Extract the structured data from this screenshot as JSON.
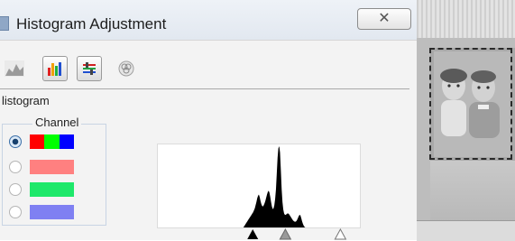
{
  "dialog": {
    "title": "Histogram Adjustment",
    "close_glyph": "✕"
  },
  "toolbar": {
    "tools": [
      {
        "icon": "mountain-histogram-icon",
        "active": false
      },
      {
        "icon": "color-bars-icon",
        "active": true
      },
      {
        "icon": "sliders-icon",
        "active": true
      },
      {
        "icon": "color-wheel-icon",
        "active": false
      }
    ]
  },
  "histogram": {
    "section_label": "listogram",
    "channel_label": "Channel",
    "channels": [
      {
        "name": "rgb",
        "checked": true,
        "colors": [
          "#ff0000",
          "#00ff00",
          "#0000ff"
        ]
      },
      {
        "name": "red",
        "checked": false,
        "colors": [
          "#ff8080"
        ]
      },
      {
        "name": "green",
        "checked": false,
        "colors": [
          "#1ee86a"
        ]
      },
      {
        "name": "blue",
        "checked": false,
        "colors": [
          "#7f80f2"
        ]
      }
    ],
    "distribution": [
      0,
      0,
      0,
      0,
      0,
      0,
      0,
      0,
      0,
      0,
      0,
      0,
      0,
      0,
      0,
      0,
      0,
      0,
      0,
      0,
      0,
      0,
      0,
      0,
      0,
      0,
      0,
      0,
      0,
      0,
      0,
      0,
      0,
      0,
      0,
      0,
      0,
      0,
      0,
      0,
      0,
      0,
      0,
      0,
      0,
      0,
      0,
      0,
      0,
      0,
      0,
      0,
      0,
      0,
      0,
      0,
      0,
      0,
      0,
      0,
      0,
      0,
      0,
      0,
      0,
      0,
      0,
      0,
      0,
      0,
      0,
      0,
      0,
      0,
      0,
      0,
      0,
      0,
      0,
      0,
      0,
      0,
      0,
      0,
      0,
      0,
      0,
      0,
      0,
      0,
      0,
      0,
      0,
      0,
      0,
      0,
      0,
      0,
      0,
      0,
      0,
      0,
      0,
      0,
      0,
      0,
      2,
      4,
      6,
      8,
      10,
      12,
      14,
      16,
      18,
      20,
      22,
      24,
      27,
      30,
      35,
      40,
      46,
      50,
      52,
      48,
      42,
      37,
      34,
      33,
      35,
      38,
      42,
      47,
      52,
      56,
      58,
      55,
      48,
      40,
      33,
      29,
      30,
      35,
      45,
      60,
      85,
      110,
      125,
      128,
      118,
      90,
      60,
      40,
      28,
      22,
      20,
      20,
      21,
      22,
      22,
      21,
      19,
      17,
      15,
      13,
      11,
      10,
      9,
      9,
      10,
      12,
      15,
      18,
      20,
      19,
      15,
      10,
      6,
      3,
      1,
      0,
      0,
      0,
      0,
      0,
      0,
      0,
      0,
      0,
      0,
      0,
      0,
      0,
      0,
      0,
      0,
      0,
      0,
      0,
      0,
      0,
      0,
      0,
      0,
      0,
      0,
      0,
      0,
      0,
      0,
      0,
      0,
      0,
      0,
      0,
      0,
      0,
      0,
      0,
      0,
      0,
      0,
      0,
      0,
      0,
      0,
      0,
      0,
      0,
      0,
      0,
      0,
      0,
      0,
      0,
      0,
      0,
      0,
      0,
      0,
      0,
      0,
      0,
      0,
      0,
      0,
      0,
      0
    ],
    "sliders": {
      "black": 0.47,
      "gray": 0.63,
      "white": 0.9
    }
  },
  "photo": {
    "description_icon": "sepia-photo-two-children"
  }
}
